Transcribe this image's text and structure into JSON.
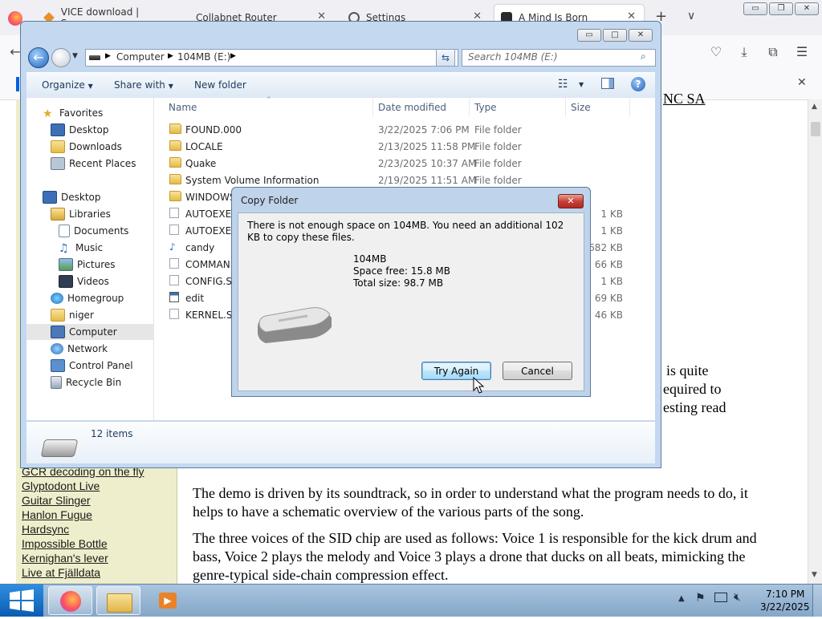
{
  "firefox": {
    "tabs": [
      {
        "label": "VICE download | Source",
        "icon": "vice-icon"
      },
      {
        "label": "Collabnet Router",
        "icon": "none"
      },
      {
        "label": "Settings",
        "icon": "gear-icon"
      },
      {
        "label": "A Mind Is Born",
        "icon": "mind-icon"
      }
    ],
    "new_tab_label": "+",
    "tab_list_label": "∨",
    "sidebar_links": [
      "GCR decoding on the fly",
      "Glyptodont Live",
      "Guitar Slinger",
      "Hanlon Fugue",
      "Hardsync",
      "Impossible Bottle",
      "Kernighan's lever",
      "Live at Fjälldata"
    ],
    "partial_header_text": "NC SA",
    "article_fragments": [
      "is quite",
      "equired to",
      "esting read"
    ],
    "article_paragraphs": [
      "The demo is driven by its soundtrack, so in order to understand what the program needs to do, it helps to have a schematic overview of the various parts of the song.",
      "The three voices of the SID chip are used as follows: Voice 1 is responsible for the kick drum and bass, Voice 2 plays the melody and Voice 3 plays a drone that ducks on all beats, mimicking the genre-typical side-chain compression effect."
    ]
  },
  "explorer": {
    "breadcrumb": [
      "Computer",
      "104MB (E:)"
    ],
    "search_placeholder": "Search 104MB (E:)",
    "toolbar": {
      "organize": "Organize",
      "share_with": "Share with",
      "new_folder": "New folder"
    },
    "nav": {
      "favorites": "Favorites",
      "favorites_items": [
        "Desktop",
        "Downloads",
        "Recent Places"
      ],
      "desktop": "Desktop",
      "libraries": "Libraries",
      "library_items": [
        "Documents",
        "Music",
        "Pictures",
        "Videos"
      ],
      "homegroup": "Homegroup",
      "user": "niger",
      "computer": "Computer",
      "network": "Network",
      "control_panel": "Control Panel",
      "recycle_bin": "Recycle Bin"
    },
    "columns": {
      "name": "Name",
      "date": "Date modified",
      "type": "Type",
      "size": "Size"
    },
    "files": [
      {
        "name": "FOUND.000",
        "date": "3/22/2025 7:06 PM",
        "type": "File folder",
        "size": "",
        "kind": "folder"
      },
      {
        "name": "LOCALE",
        "date": "2/13/2025 11:58 PM",
        "type": "File folder",
        "size": "",
        "kind": "folder"
      },
      {
        "name": "Quake",
        "date": "2/23/2025 10:37 AM",
        "type": "File folder",
        "size": "",
        "kind": "folder"
      },
      {
        "name": "System Volume Information",
        "date": "2/19/2025 11:51 AM",
        "type": "File folder",
        "size": "",
        "kind": "folder"
      },
      {
        "name": "WINDOWS",
        "date": "",
        "type": "",
        "size": "",
        "kind": "folder"
      },
      {
        "name": "AUTOEXEC",
        "date": "",
        "type": "",
        "size": "1 KB",
        "kind": "doc"
      },
      {
        "name": "AUTOEXEC",
        "date": "",
        "type": "",
        "size": "1 KB",
        "kind": "doc"
      },
      {
        "name": "candy",
        "date": "",
        "type": "",
        "size": "682 KB",
        "kind": "audio"
      },
      {
        "name": "COMMAN",
        "date": "",
        "type": "",
        "size": "66 KB",
        "kind": "doc"
      },
      {
        "name": "CONFIG.SY",
        "date": "",
        "type": "",
        "size": "1 KB",
        "kind": "doc"
      },
      {
        "name": "edit",
        "date": "",
        "type": "",
        "size": "69 KB",
        "kind": "app"
      },
      {
        "name": "KERNEL.SY",
        "date": "",
        "type": "",
        "size": "46 KB",
        "kind": "doc"
      }
    ],
    "item_count": "12 items"
  },
  "dialog": {
    "title": "Copy Folder",
    "message": "There is not enough space on 104MB. You need an additional 102 KB to copy these files.",
    "drive_name": "104MB",
    "space_free": "Space free: 15.8 MB",
    "total_size": "Total size: 98.7 MB",
    "try_again": "Try Again",
    "cancel": "Cancel",
    "close_glyph": "✕"
  },
  "taskbar": {
    "time": "7:10 PM",
    "date": "3/22/2025"
  },
  "colors": {
    "accent": "#3c7fb1",
    "close_red": "#c7423a",
    "page_sidebar": "#eeeecc"
  }
}
